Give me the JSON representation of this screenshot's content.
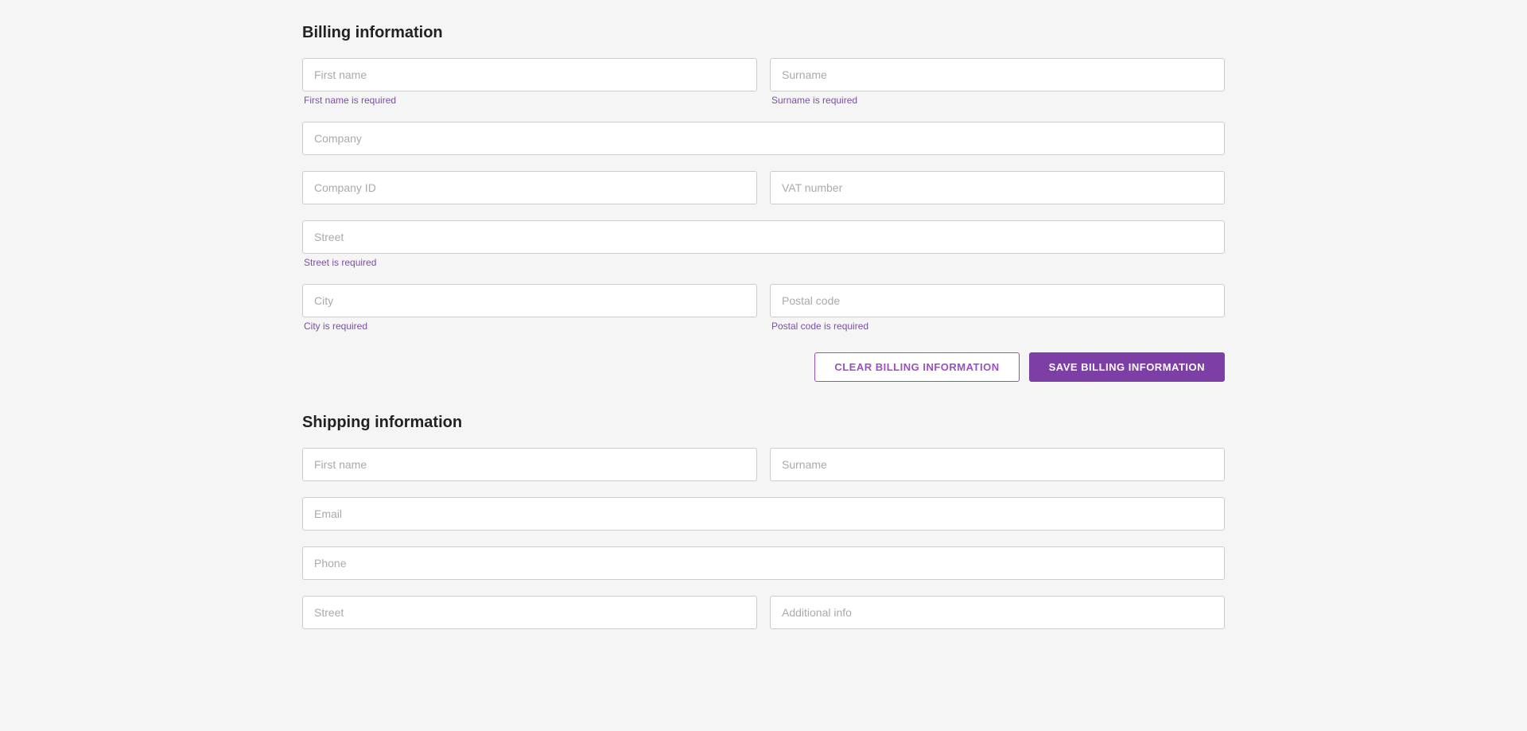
{
  "billing": {
    "section_title": "Billing information",
    "first_name": {
      "placeholder": "First name",
      "error": "First name is required"
    },
    "surname": {
      "placeholder": "Surname",
      "error": "Surname is required"
    },
    "company": {
      "placeholder": "Company"
    },
    "company_id": {
      "placeholder": "Company ID"
    },
    "vat_number": {
      "placeholder": "VAT number"
    },
    "street": {
      "placeholder": "Street",
      "error": "Street is required"
    },
    "city": {
      "placeholder": "City",
      "error": "City is required"
    },
    "postal_code": {
      "placeholder": "Postal code",
      "error": "Postal code is required"
    },
    "clear_button": "CLEAR BILLING INFORMATION",
    "save_button": "SAVE BILLING INFORMATION"
  },
  "shipping": {
    "section_title": "Shipping information",
    "first_name": {
      "placeholder": "First name"
    },
    "surname": {
      "placeholder": "Surname"
    },
    "email": {
      "placeholder": "Email"
    },
    "phone": {
      "placeholder": "Phone"
    },
    "street": {
      "placeholder": "Street"
    },
    "additional_info": {
      "placeholder": "Additional info"
    }
  }
}
